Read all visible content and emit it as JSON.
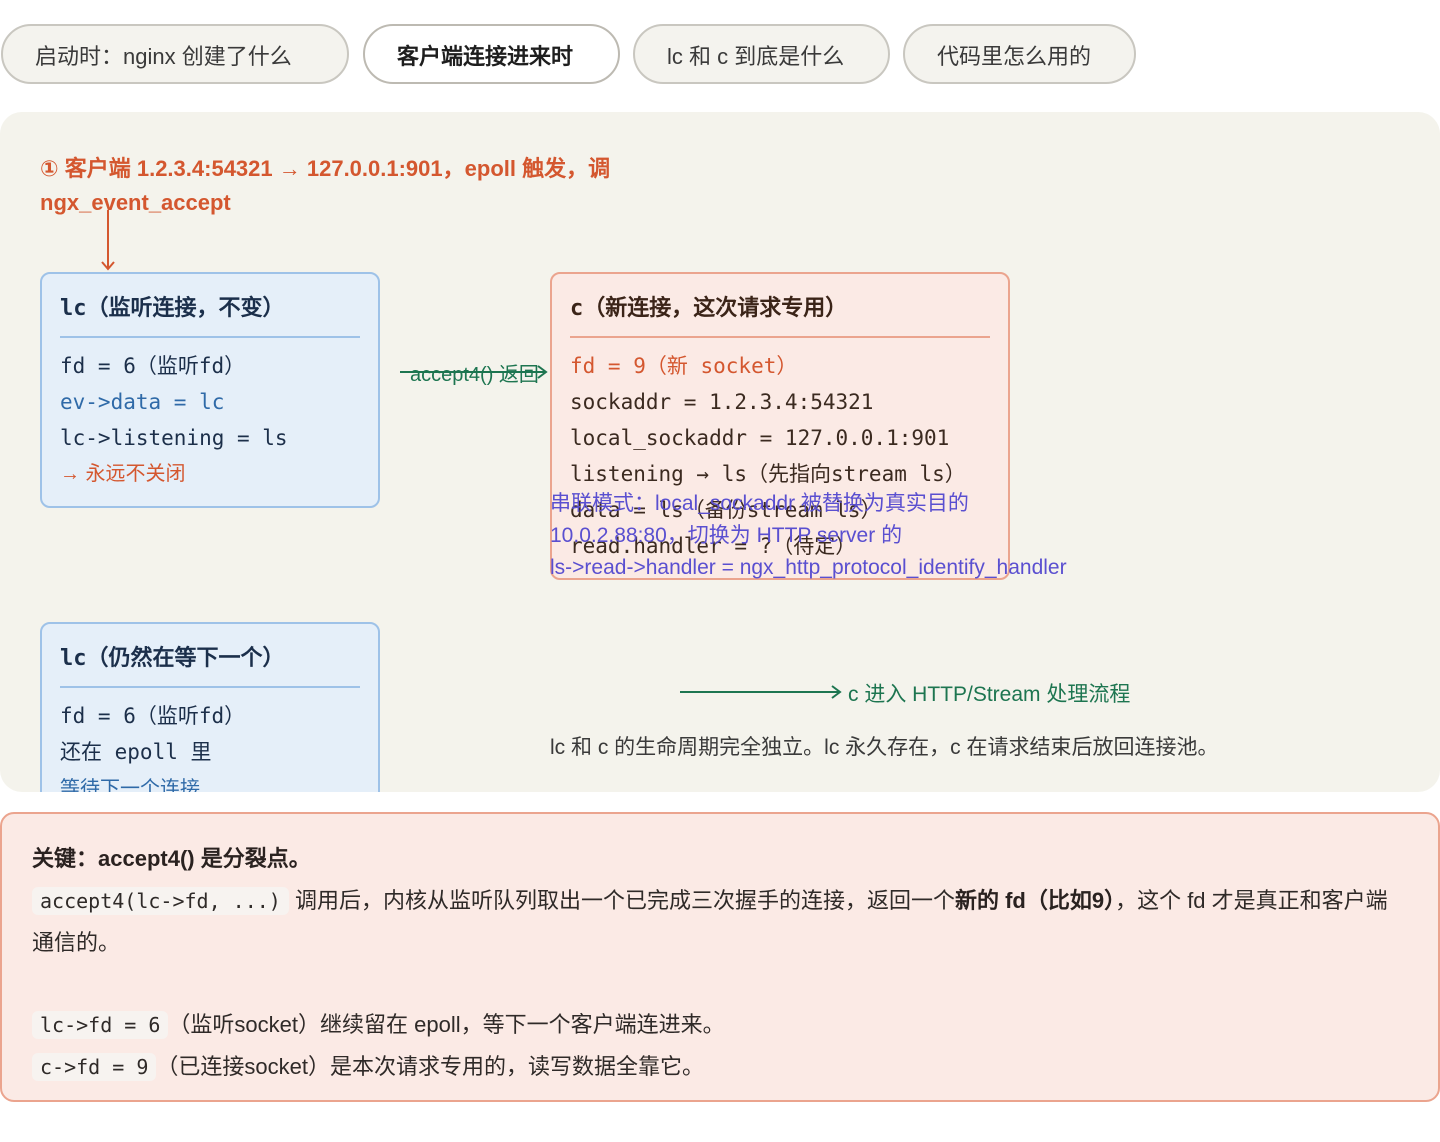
{
  "tabs": [
    {
      "label": "启动时：nginx 创建了什么"
    },
    {
      "label": "客户端连接进来时"
    },
    {
      "label": "lc 和 c 到底是什么"
    },
    {
      "label": "代码里怎么用的"
    }
  ],
  "diagram": {
    "step1": "① 客户端 1.2.3.4:54321 → 127.0.0.1:901，epoll 触发，调 ngx_event_accept",
    "lc_box": {
      "title": "lc（监听连接，不变）",
      "lines": [
        "fd = 6（监听fd）",
        "ev->data = lc",
        "lc->listening = ls",
        "→ 永远不关闭"
      ]
    },
    "accept_label": "accept4() 返回",
    "c_box": {
      "title": "c（新连接，这次请求专用）",
      "lines": [
        "fd = 9（新 socket）",
        "sockaddr = 1.2.3.4:54321",
        "local_sockaddr = 127.0.0.1:901",
        "listening → ls（先指向stream ls）",
        "data = ls（备份stream ls）",
        "read.handler = ?（待定）"
      ]
    },
    "overlay_lines": [
      "串联模式：local_sockaddr 被替换为真实目的",
      "10.0.2.88:80，切换为 HTTP server 的",
      "ls->read->handler = ngx_http_protocol_identify_handler"
    ],
    "lc2_box": {
      "title": "lc（仍然在等下一个）",
      "lines": [
        "fd = 6（监听fd）",
        "还在 epoll 里",
        "等待下一个连接"
      ]
    },
    "http_label": "c 进入 HTTP/Stream 处理流程",
    "lifecycle": "lc 和 c 的生命周期完全独立。lc 永久存在，c 在请求结束后放回连接池。"
  },
  "callout": {
    "heading": "关键：accept4() 是分裂点。",
    "code1": "accept4(lc->fd, ...)",
    "p1_a": " 调用后，内核从监听队列取出一个已完成三次握手的连接，返回一个",
    "p1_b": "新的 fd（比如9）",
    "p1_c": "，这个 fd 才是真正和客户端通信的。",
    "code2": "lc->fd = 6",
    "p2": "（监听socket）继续留在 epoll，等下一个客户端连进来。",
    "code3": "c->fd = 9",
    "p3": "（已连接socket）是本次请求专用的，读写数据全靠它。"
  },
  "colors": {
    "accent_orange": "#d4572f",
    "accent_green": "#1d7550",
    "overlay_purple": "#5a4fd0",
    "blue_box": "#e5eff9",
    "orange_box": "#fbeae5"
  }
}
